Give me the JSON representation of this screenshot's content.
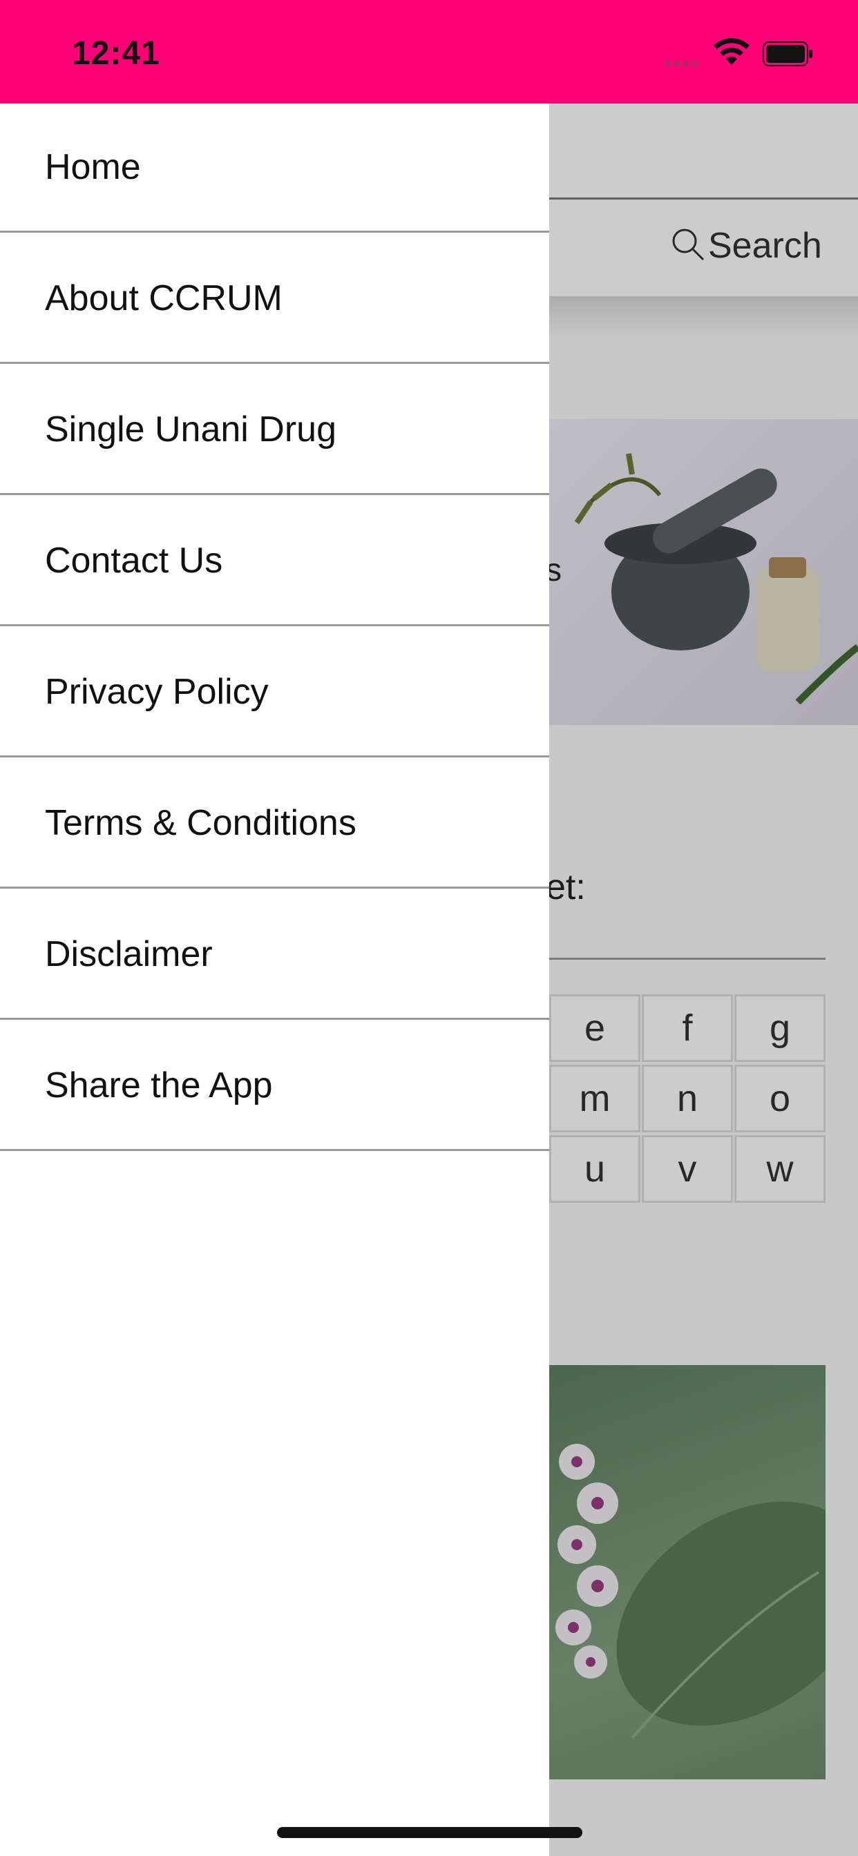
{
  "status_bar": {
    "time": "12:41",
    "background_color": "#ff0077",
    "icons": [
      "cellular-signal-icon",
      "wifi-icon",
      "battery-icon"
    ]
  },
  "background_screen": {
    "search_label": "Search",
    "partial_text_1": "s",
    "partial_text_2": "et:",
    "alphabet_letters": [
      "e",
      "f",
      "g",
      "m",
      "n",
      "o",
      "u",
      "v",
      "w"
    ]
  },
  "drawer": {
    "items": [
      {
        "label": "Home"
      },
      {
        "label": "About CCRUM"
      },
      {
        "label": "Single Unani Drug"
      },
      {
        "label": "Contact Us"
      },
      {
        "label": "Privacy Policy"
      },
      {
        "label": "Terms & Conditions"
      },
      {
        "label": "Disclaimer"
      },
      {
        "label": "Share the App"
      }
    ]
  }
}
